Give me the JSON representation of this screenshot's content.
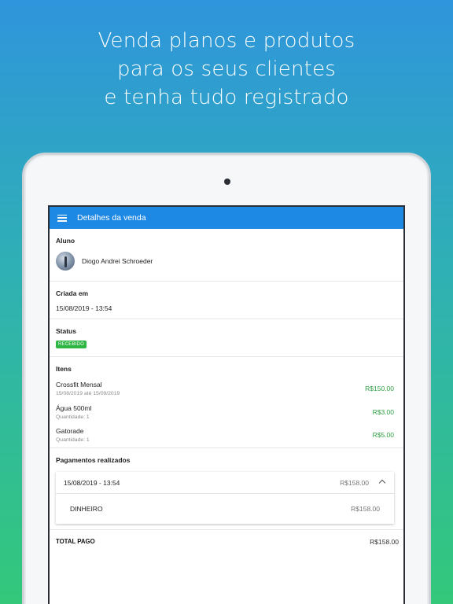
{
  "headline": {
    "line1": "Venda planos e produtos",
    "line2": "para os seus clientes",
    "line3": "e tenha tudo registrado"
  },
  "appbar": {
    "title": "Detalhes da venda",
    "menu_icon": "hamburger-menu-icon"
  },
  "aluno": {
    "label": "Aluno",
    "name": "Diogo Andrei Schroeder"
  },
  "criada": {
    "label": "Criada em",
    "value": "15/08/2019 - 13:54"
  },
  "status": {
    "label": "Status",
    "badge": "RECEBIDO",
    "badge_color": "#2fb544"
  },
  "itens": {
    "label": "Itens",
    "price_color": "#2ea043",
    "items": [
      {
        "name": "Crossfit Mensal",
        "sub": "15/08/2019 até 15/09/2019",
        "price": "R$150.00"
      },
      {
        "name": "Água 500ml",
        "sub": "Quantidade: 1",
        "price": "R$3.00"
      },
      {
        "name": "Gatorade",
        "sub": "Quantidade: 1",
        "price": "R$5.00"
      }
    ]
  },
  "pagamentos": {
    "label": "Pagamentos realizados",
    "date": "15/08/2019 - 13:54",
    "total": "R$158.00",
    "method": "DINHEIRO",
    "amount": "R$158.00"
  },
  "total": {
    "label": "TOTAL PAGO",
    "value": "R$158.00"
  },
  "colors": {
    "appbar": "#1e88e5"
  }
}
